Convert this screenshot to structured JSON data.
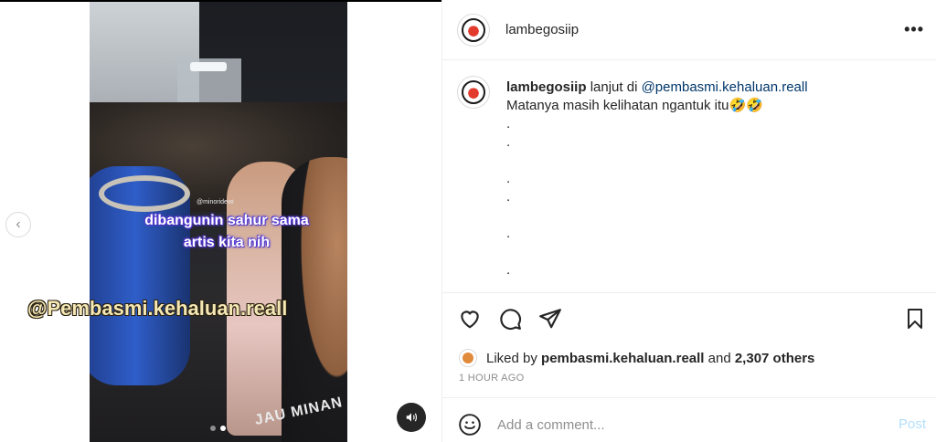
{
  "media": {
    "video_caption_line1": "dibangunin sahur sama",
    "video_caption_line2": "artis kita nih",
    "video_watermark": "@minoridewi",
    "overlay_handle": "@Pembasmi.kehaluan.reall",
    "shirt_text": "JAU MINAN",
    "carousel_dots": 2,
    "active_dot": 2,
    "prev_icon": "chevron-left-icon",
    "mute_icon": "speaker-icon"
  },
  "header": {
    "username": "lambegosiip",
    "more_icon": "more-horizontal-icon"
  },
  "caption": {
    "username": "lambegosiip",
    "text_prefix": "lanjut di",
    "mention": "@pembasmi.kehaluan.reall",
    "line2": "Matanya masih kelihatan ngantuk itu🤣🤣",
    "dot_lines": [
      ".",
      ".",
      "",
      ".",
      ".",
      "",
      ".",
      "",
      "."
    ]
  },
  "actions": {
    "like_icon": "heart-icon",
    "comment_icon": "comment-icon",
    "share_icon": "paper-plane-icon",
    "save_icon": "bookmark-icon"
  },
  "likes": {
    "prefix": "Liked by",
    "user": "pembasmi.kehaluan.reall",
    "and": "and",
    "others": "2,307 others"
  },
  "timestamp": "1 HOUR AGO",
  "comment_box": {
    "placeholder": "Add a comment...",
    "post_label": "Post",
    "emoji_icon": "smiley-icon"
  },
  "colors": {
    "link": "#00376b",
    "post_disabled": "#b2dffc",
    "muted": "#8e8e8e",
    "border": "#efefef"
  }
}
